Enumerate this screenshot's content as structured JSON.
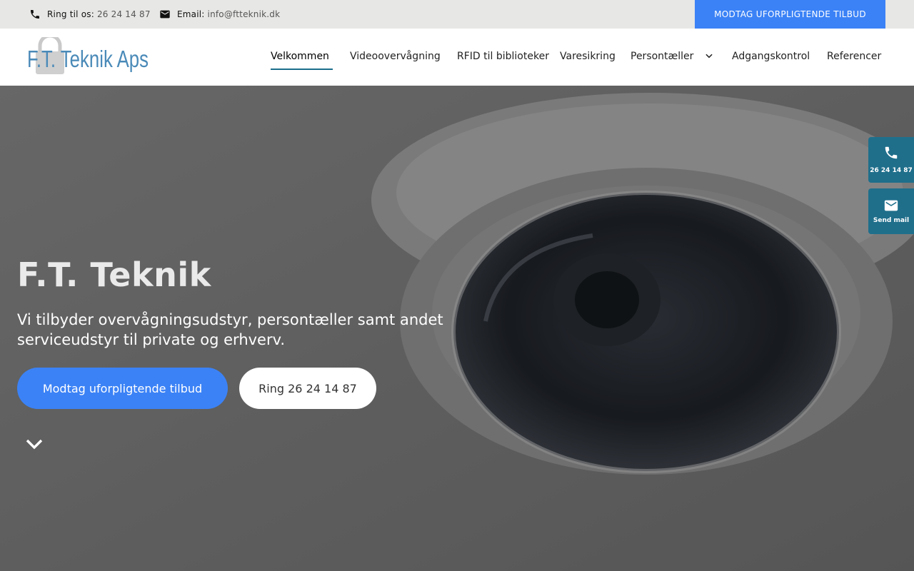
{
  "topbar": {
    "phone_label": "Ring til os:",
    "phone_value": "26 24 14 87",
    "email_label": "Email:",
    "email_value": "info@ftteknik.dk",
    "cta_label": "MODTAG UFORPLIGTENDE TILBUD"
  },
  "logo": {
    "text": "F.T. Teknik Aps"
  },
  "nav": {
    "items": [
      {
        "label": "Velkommen"
      },
      {
        "label": "Videoovervågning"
      },
      {
        "label": "RFID til biblioteker"
      },
      {
        "label": "Varesikring"
      },
      {
        "label": "Persontæller"
      },
      {
        "label": "Adgangskontrol"
      },
      {
        "label": "Referencer"
      }
    ]
  },
  "hero": {
    "title": "F.T. Teknik",
    "subtitle": "Vi tilbyder overvågningsudstyr, persontæller samt andet serviceudstyr til private og erhverv.",
    "primary_button": "Modtag uforpligtende tilbud",
    "secondary_button": "Ring 26 24 14 87"
  },
  "floating": {
    "phone_label": "26 24 14 87",
    "mail_label": "Send mail"
  },
  "colors": {
    "accent_blue": "#3b82f6",
    "teal": "#1f6f8b",
    "topbar_bg": "#e7e7e5"
  },
  "icons": [
    "phone-icon",
    "mail-icon",
    "chevron-down-icon",
    "logo-lock-icon"
  ]
}
